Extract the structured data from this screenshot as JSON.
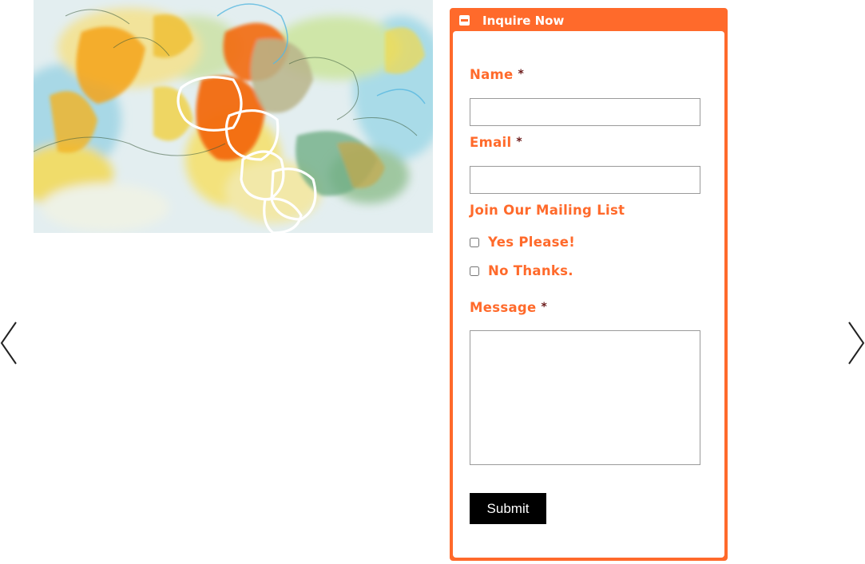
{
  "artwork": {
    "alt": "abstract painting"
  },
  "nav": {
    "prev_icon": "chevron-left-icon",
    "next_icon": "chevron-right-icon"
  },
  "panel": {
    "title": "Inquire Now",
    "collapse_icon": "minus-square-icon",
    "accent_color": "#ff6a2b"
  },
  "form": {
    "name_label": "Name",
    "email_label": "Email",
    "required_mark": "*",
    "mailing_label": "Join Our Mailing List",
    "options": [
      "Yes Please!",
      "No Thanks."
    ],
    "message_label": "Message",
    "submit_label": "Submit"
  }
}
